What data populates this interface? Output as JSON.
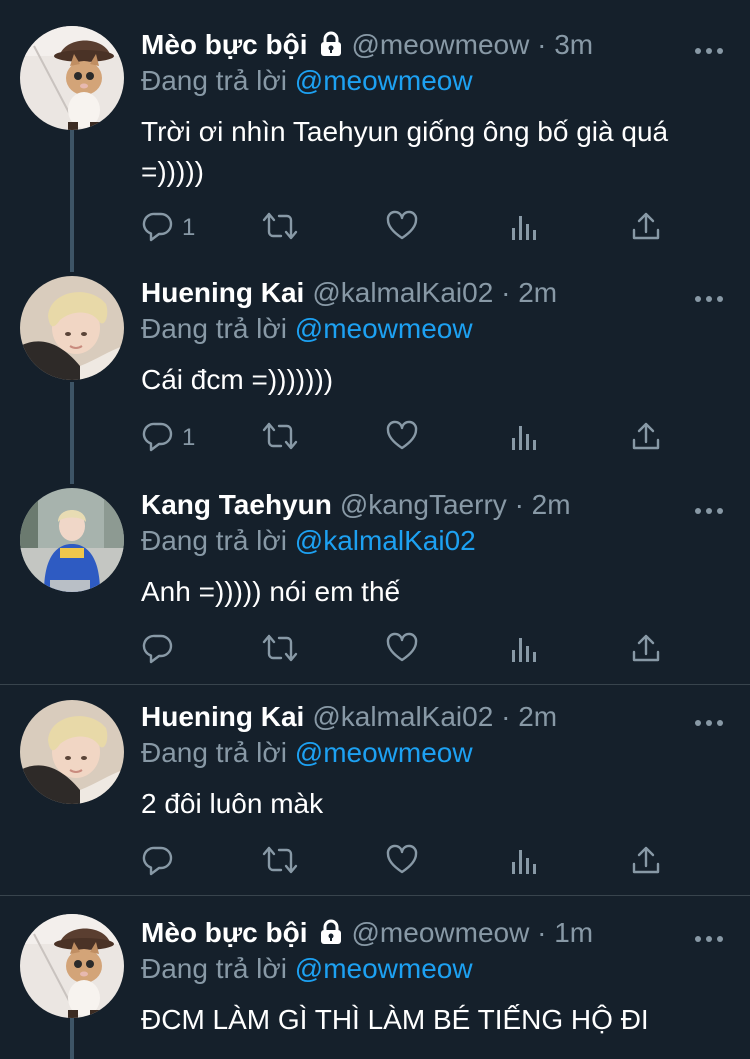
{
  "reply_prefix": "Đang trả lời",
  "tweets": [
    {
      "name": "Mèo bực bội",
      "locked": true,
      "handle": "@meowmeow",
      "dot": "·",
      "time": "3m",
      "reply_to": "@meowmeow",
      "text": "Trời ơi nhìn Taehyun giống ông bố già quá =)))))",
      "reply_count": "1",
      "avatar": "cat-avatar"
    },
    {
      "name": "Huening Kai",
      "locked": false,
      "handle": "@kalmalKai02",
      "dot": "·",
      "time": "2m",
      "reply_to": "@meowmeow",
      "text": "Cái đcm =)))))))",
      "reply_count": "1",
      "avatar": "blond-person-avatar"
    },
    {
      "name": "Kang Taehyun",
      "locked": false,
      "handle": "@kangTaerry",
      "dot": "·",
      "time": "2m",
      "reply_to": "@kalmalKai02",
      "text": "Anh =))))) nói em thế",
      "reply_count": "",
      "avatar": "blue-sweater-person-avatar"
    },
    {
      "name": "Huening Kai",
      "locked": false,
      "handle": "@kalmalKai02",
      "dot": "·",
      "time": "2m",
      "reply_to": "@meowmeow",
      "text": "2 đôi luôn màk",
      "reply_count": "",
      "avatar": "blond-person-avatar"
    },
    {
      "name": "Mèo bực bội",
      "locked": true,
      "handle": "@meowmeow",
      "dot": "·",
      "time": "1m",
      "reply_to": "@meowmeow",
      "text": "ĐCM LÀM GÌ THÌ LÀM BÉ TIẾNG HỘ ĐI",
      "reply_count": "",
      "avatar": "cat-avatar"
    }
  ],
  "colors": {
    "background": "#15202b",
    "text": "#ffffff",
    "secondary": "#8899a6",
    "link": "#1da1f2",
    "divider": "#38444d"
  },
  "icons": [
    "reply-icon",
    "retweet-icon",
    "like-icon",
    "analytics-icon",
    "share-icon",
    "more-icon",
    "lock-icon"
  ]
}
